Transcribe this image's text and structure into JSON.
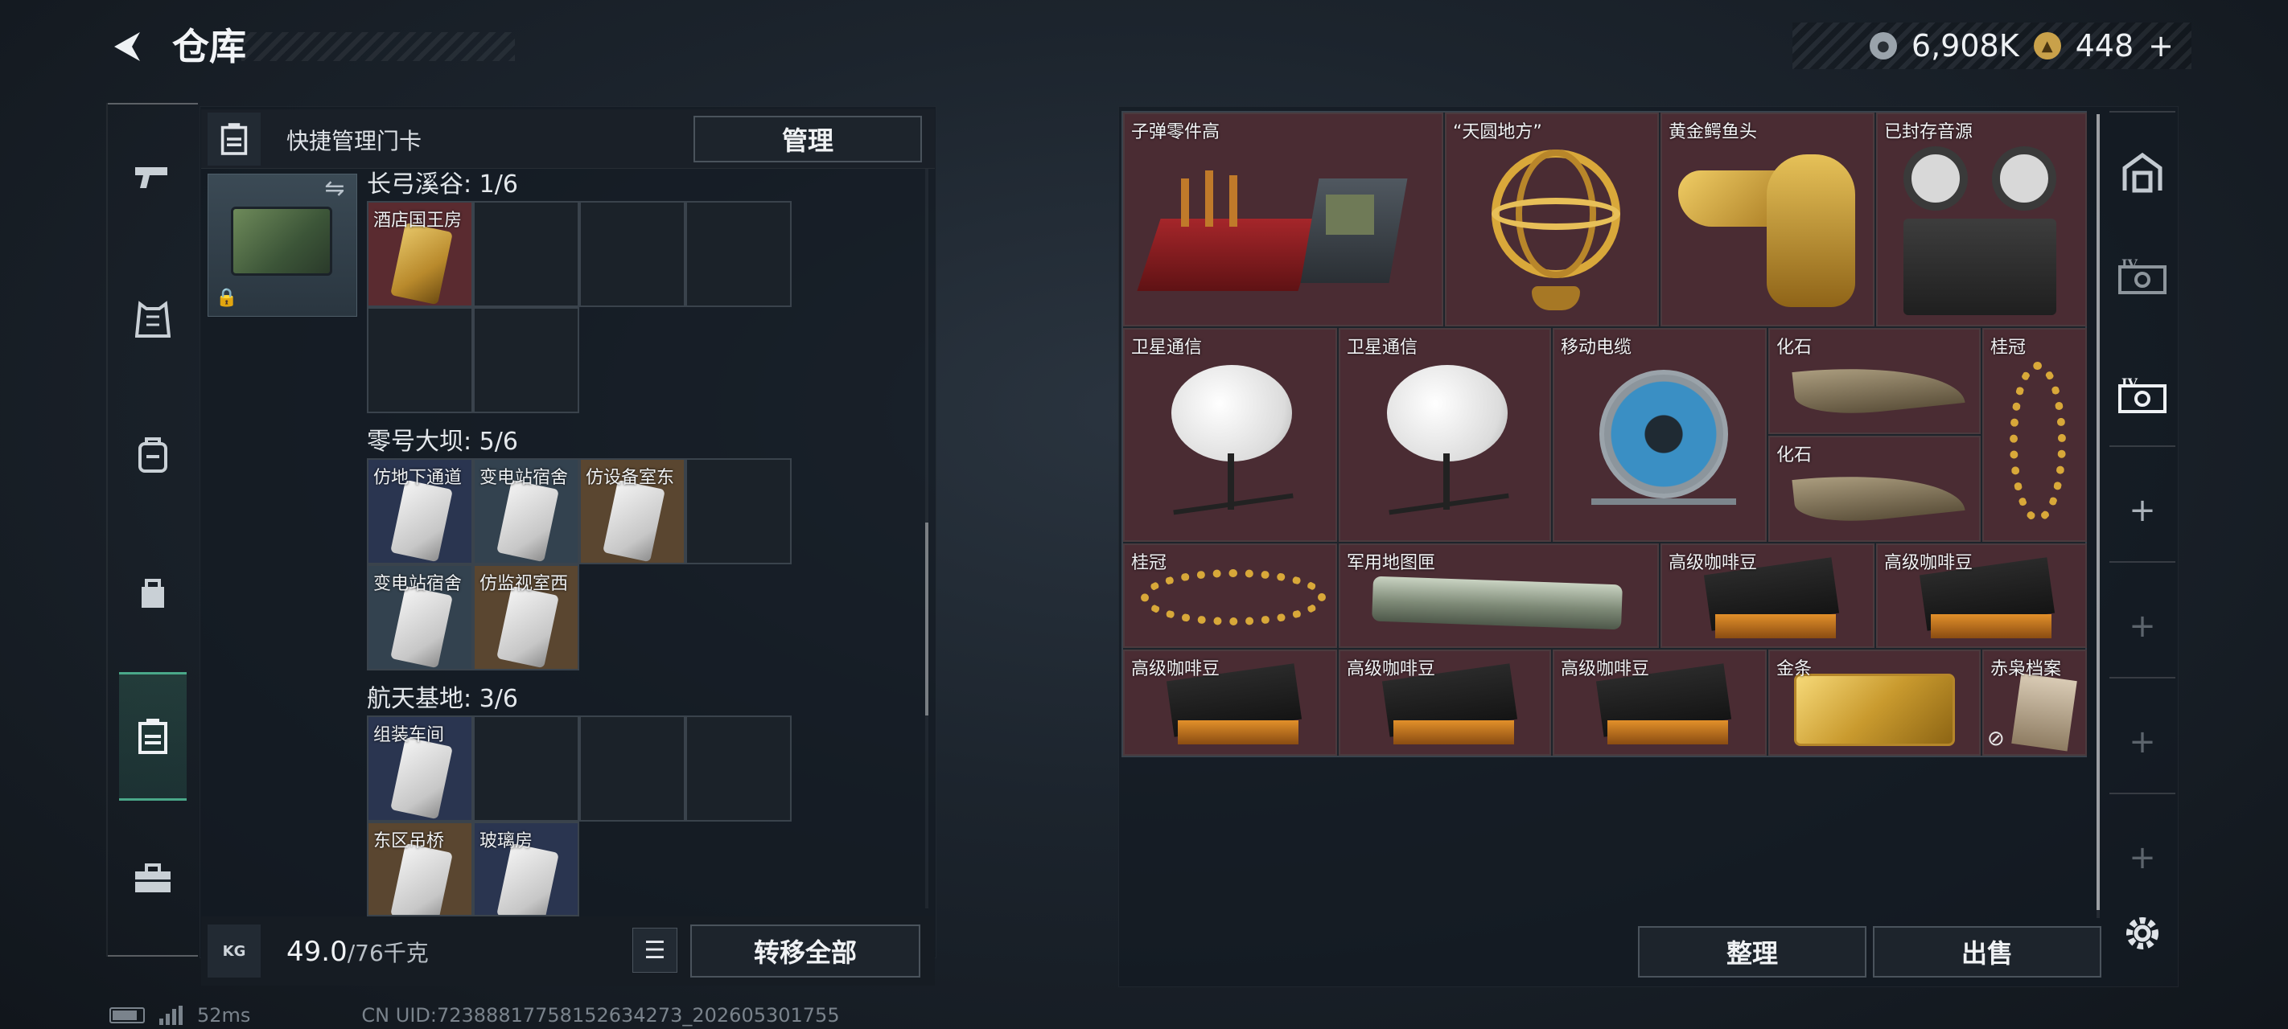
{
  "header": {
    "title": "仓库",
    "currency_silver": "6,908K",
    "currency_gold": "448",
    "add_symbol": "+"
  },
  "left_panel": {
    "header_title": "快捷管理门卡",
    "manage_label": "管理",
    "sections": [
      {
        "title": "长弓溪谷: 1/6",
        "cards": [
          "酒店国王房"
        ]
      },
      {
        "title": "零号大坝: 5/6",
        "cards": [
          "仿地下通道",
          "变电站宿舍",
          "仿设备室东",
          "变电站宿舍",
          "仿监视室西"
        ]
      },
      {
        "title": "航天基地: 3/6",
        "cards": [
          "组装车间",
          "东区吊桥",
          "玻璃房"
        ]
      }
    ],
    "weight_icon_text": "KG",
    "weight_value": "49.0",
    "weight_max": "/76千克",
    "transfer_all_label": "转移全部"
  },
  "right_panel": {
    "items": [
      {
        "label": "子弹零件高",
        "icon": "ammo-parts-box"
      },
      {
        "label": "“天圆地方”",
        "icon": "golden-armillary-sphere"
      },
      {
        "label": "黄金鳄鱼头",
        "icon": "golden-crocodile-head"
      },
      {
        "label": "已封存音源",
        "icon": "reel-tape-recorder"
      },
      {
        "label": "卫星通信",
        "icon": "satellite-dish"
      },
      {
        "label": "卫星通信",
        "icon": "satellite-dish"
      },
      {
        "label": "移动电缆",
        "icon": "cable-reel"
      },
      {
        "label": "化石",
        "icon": "fossil-claw"
      },
      {
        "label": "化石",
        "icon": "fossil-claw"
      },
      {
        "label": "桂冠",
        "icon": "laurel-wreath"
      },
      {
        "label": "桂冠",
        "icon": "laurel-wreath"
      },
      {
        "label": "军用地图匣",
        "icon": "map-tube"
      },
      {
        "label": "高级咖啡豆",
        "icon": "coffee-bag"
      },
      {
        "label": "高级咖啡豆",
        "icon": "coffee-bag"
      },
      {
        "label": "高级咖啡豆",
        "icon": "coffee-bag"
      },
      {
        "label": "高级咖啡豆",
        "icon": "coffee-bag"
      },
      {
        "label": "高级咖啡豆",
        "icon": "coffee-bag"
      },
      {
        "label": "金条",
        "icon": "gold-bar"
      },
      {
        "label": "赤枭档案",
        "icon": "dossier"
      }
    ],
    "sort_label": "整理",
    "sell_label": "出售"
  },
  "status_bar": {
    "ping": "52ms",
    "uid": "CN UID:7238881775815263427‪3_202605301755"
  },
  "colors": {
    "item_bg": "#4a2c33",
    "accent_green": "#4aa889",
    "gold": "#d4a843"
  }
}
